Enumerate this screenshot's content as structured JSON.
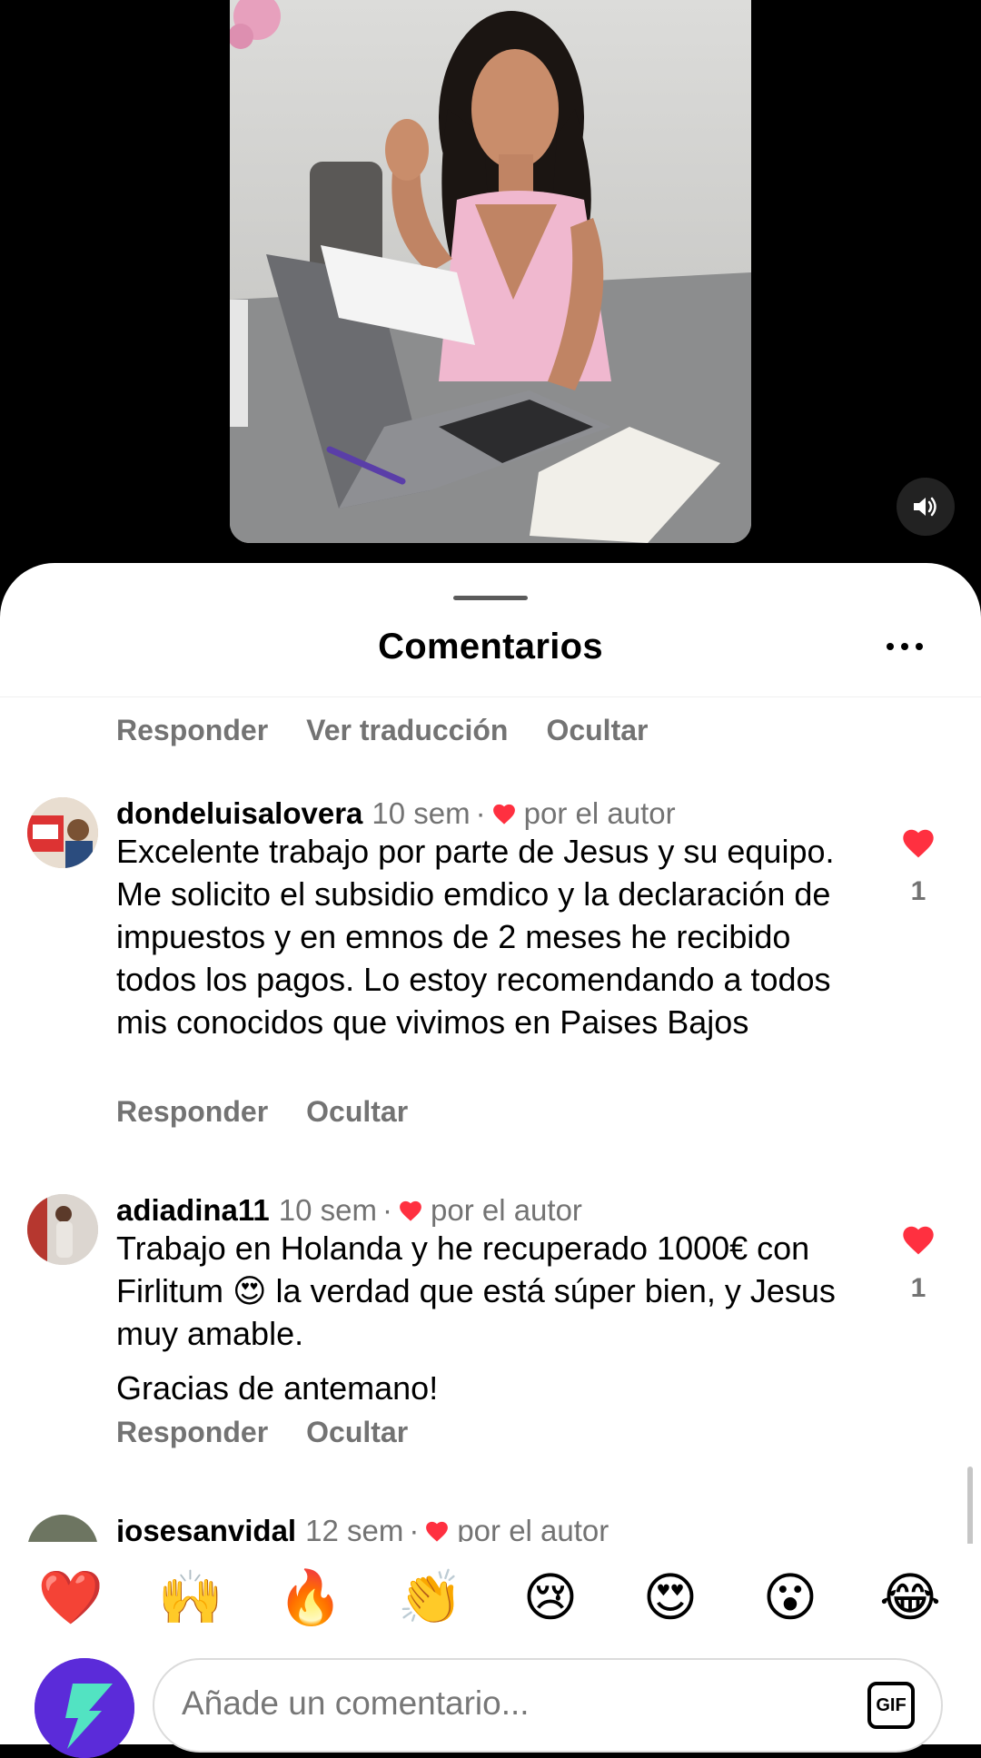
{
  "sheet": {
    "title": "Comentarios"
  },
  "top_actions": [
    "Responder",
    "Ver traducción",
    "Ocultar"
  ],
  "comments": [
    {
      "username": "dondeluisalovera",
      "time": "10 sem",
      "separator": "·",
      "liked_by": "por el autor",
      "text": "Excelente trabajo por parte de Jesus y su equipo. Me solicito el subsidio emdico y la declaración de impuestos y en emnos de 2 meses he recibido todos los pagos. Lo estoy recomendando a todos mis conocidos que vivimos en Paises Bajos",
      "likes": "1",
      "actions": [
        "Responder",
        "Ocultar"
      ]
    },
    {
      "username": "adiadina11",
      "time": "10 sem",
      "separator": "·",
      "liked_by": "por el autor",
      "text": "Trabajo en Holanda y he recuperado 1000€ con Firlitum 😍 la verdad que está súper bien, y Jesus muy amable.",
      "text2": "Gracias de antemano!",
      "likes": "1",
      "actions": [
        "Responder",
        "Ocultar"
      ]
    },
    {
      "username": "josesanvidal",
      "time": "12 sem",
      "separator": "·",
      "liked_by": "por el autor"
    }
  ],
  "emoji_bar": [
    "❤️",
    "🙌",
    "🔥",
    "👏",
    "😢",
    "😍",
    "😮",
    "😂"
  ],
  "input": {
    "placeholder": "Añade un comentario...",
    "gif_label": "GIF"
  },
  "icons": {
    "volume": "speaker-icon",
    "more": "more-options-icon",
    "heart": "heart-icon",
    "gif": "gif-icon"
  },
  "colors": {
    "heart": "#ff3040",
    "muted_text": "#737373",
    "avatar_bg": "#5b2bd9"
  }
}
